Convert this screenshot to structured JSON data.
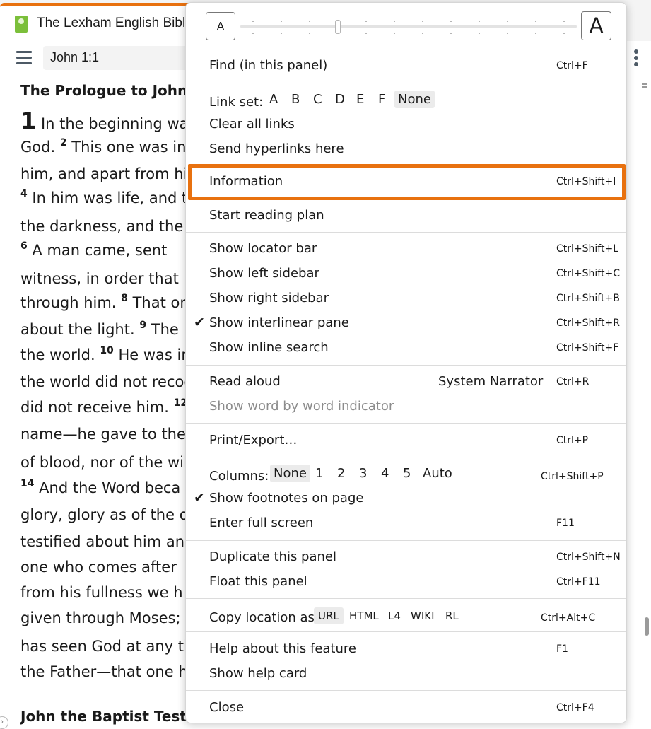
{
  "tab": {
    "title": "The Lexham English Bible"
  },
  "toolbar": {
    "reference": "John 1:1"
  },
  "reader": {
    "heading1": "The Prologue to John’s",
    "chapter": "1",
    "lines": [
      {
        "v": "",
        "t": " In the beginning wa"
      },
      {
        "v": "",
        "t": "God. ",
        "v2": "2",
        "t2": " This one was in"
      },
      {
        "v": "",
        "t": "him, and apart from hi"
      },
      {
        "v": "4",
        "t": " In him was life, and t"
      },
      {
        "v": "",
        "t": "the darkness, and the d"
      },
      {
        "v": "6",
        "t": " A man came, sent"
      },
      {
        "v": "",
        "t": "witness, in order that"
      },
      {
        "v": "",
        "t": "through him. ",
        "v2": "8",
        "t2": " That or"
      },
      {
        "v": "",
        "t": "about the light. ",
        "v2": "9",
        "t2": " The"
      },
      {
        "v": "",
        "t": "the world. ",
        "v2": "10",
        "t2": " He was in"
      },
      {
        "v": "",
        "t": "the world did not recog"
      },
      {
        "v": "",
        "t": "did not receive him. ",
        "v2": "12",
        "t2": ""
      },
      {
        "v": "",
        "t": "name—he gave to ther"
      },
      {
        "v": "",
        "t": "of blood, nor of the wil"
      },
      {
        "v": "14",
        "t": " And the Word beca"
      },
      {
        "v": "",
        "t": "glory, glory as of the o"
      },
      {
        "v": "",
        "t": "testified about him and"
      },
      {
        "v": "",
        "t": "one who comes after"
      },
      {
        "v": "",
        "t": "from his fullness we h"
      },
      {
        "v": "",
        "t": "given through Moses; g"
      },
      {
        "v": "",
        "t": "has seen God at any ti"
      },
      {
        "v": "",
        "t": "the Father—that one ha"
      }
    ],
    "heading2": "John the Baptist Testifi"
  },
  "menu": {
    "font_small": "A",
    "font_large": "A",
    "find": {
      "label": "Find (in this panel)",
      "shortcut": "Ctrl+F"
    },
    "link_set": {
      "label": "Link set:",
      "options": [
        "A",
        "B",
        "C",
        "D",
        "E",
        "F",
        "None"
      ],
      "selected": "None"
    },
    "clear_links": "Clear all links",
    "send_hyperlinks": "Send hyperlinks here",
    "information": {
      "label": "Information",
      "shortcut": "Ctrl+Shift+I"
    },
    "reading_plan": "Start reading plan",
    "show_locator": {
      "label": "Show locator bar",
      "shortcut": "Ctrl+Shift+L"
    },
    "show_left": {
      "label": "Show left sidebar",
      "shortcut": "Ctrl+Shift+C"
    },
    "show_right": {
      "label": "Show right sidebar",
      "shortcut": "Ctrl+Shift+B"
    },
    "show_interlinear": {
      "label": "Show interlinear pane",
      "shortcut": "Ctrl+Shift+R",
      "checked": true
    },
    "show_inline_search": {
      "label": "Show inline search",
      "shortcut": "Ctrl+Shift+F"
    },
    "read_aloud": {
      "label": "Read aloud",
      "voice": "System Narrator",
      "shortcut": "Ctrl+R"
    },
    "word_indicator": "Show word by word indicator",
    "print_export": {
      "label": "Print/Export…",
      "shortcut": "Ctrl+P"
    },
    "columns": {
      "label": "Columns:",
      "options": [
        "None",
        "1",
        "2",
        "3",
        "4",
        "5",
        "Auto"
      ],
      "selected": "None",
      "shortcut": "Ctrl+Shift+P"
    },
    "show_footnotes": {
      "label": "Show footnotes on page",
      "checked": true
    },
    "full_screen": {
      "label": "Enter full screen",
      "shortcut": "F11"
    },
    "duplicate": {
      "label": "Duplicate this panel",
      "shortcut": "Ctrl+Shift+N"
    },
    "float": {
      "label": "Float this panel",
      "shortcut": "Ctrl+F11"
    },
    "copy_location": {
      "label": "Copy location as:",
      "options": [
        "URL",
        "HTML",
        "L4",
        "WIKI",
        "RL"
      ],
      "selected": "URL",
      "shortcut": "Ctrl+Alt+C"
    },
    "help_feature": {
      "label": "Help about this feature",
      "shortcut": "F1"
    },
    "help_card": "Show help card",
    "close": {
      "label": "Close",
      "shortcut": "Ctrl+F4"
    },
    "check_glyph": "✔"
  },
  "colors": {
    "accent": "#e8710f",
    "brand_green": "#7bbf3a",
    "selected_bg": "#ebebeb"
  }
}
